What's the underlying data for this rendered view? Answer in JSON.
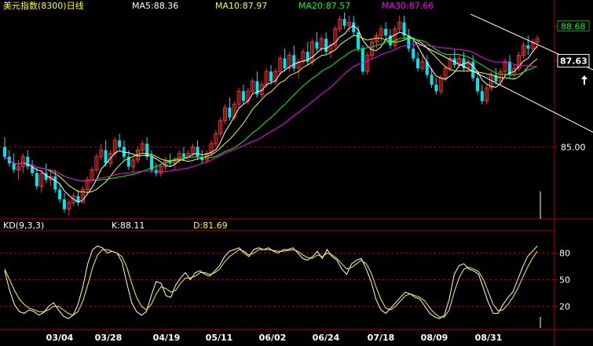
{
  "header": {
    "instrument": "美元指数(8300)日线",
    "ma5": "MA5:88.36",
    "ma10": "MA10:87.97",
    "ma20": "MA20:87.57",
    "ma30": "MA30:87.66"
  },
  "kd_header": {
    "name": "KD(9,3,3)",
    "k": "K:88.11",
    "d": "D:81.69"
  },
  "colors": {
    "up": "#ff3030",
    "down": "#00e5ee",
    "ma5": "#ffffff",
    "ma10": "#ffff00",
    "ma20": "#00ff00",
    "ma30": "#ff00ff",
    "channel": "#ffffff",
    "frame": "#b00000",
    "k": "#ffffff",
    "d": "#ffff00",
    "axis_text": "#ffffff",
    "header_ma5": "#ffffff",
    "header_ma10": "#ffff00",
    "header_ma20": "#00ff00",
    "header_ma30": "#ff00ff",
    "header_title": "#ffff00"
  },
  "chart_data": [
    {
      "type": "candlestick",
      "title": "美元指数(8300)日线",
      "x_ticks": [
        "03/04",
        "03/28",
        "04/19",
        "05/11",
        "06/02",
        "06/24",
        "07/18",
        "08/09",
        "08/31"
      ],
      "y_ticks": [
        "88.68",
        "87.63",
        "85.00"
      ],
      "y_range": [
        82.9,
        89.1
      ],
      "channel_lines": [
        {
          "from": [
            101.5,
            89.05
          ],
          "to": [
            134.5,
            86.95
          ]
        },
        {
          "from": [
            89.5,
            88.2
          ],
          "to": [
            134.5,
            85.0
          ]
        }
      ],
      "series": [
        {
          "name": "MA5",
          "value": 88.36
        },
        {
          "name": "MA10",
          "value": 87.97
        },
        {
          "name": "MA20",
          "value": 87.57
        },
        {
          "name": "MA30",
          "value": 87.66
        }
      ],
      "ohlc": [
        [
          85.0,
          85.3,
          84.6,
          84.7
        ],
        [
          84.7,
          84.9,
          84.4,
          84.5
        ],
        [
          84.5,
          84.8,
          84.2,
          84.3
        ],
        [
          84.3,
          84.6,
          84.0,
          84.4
        ],
        [
          84.4,
          84.8,
          84.2,
          84.7
        ],
        [
          84.7,
          84.9,
          84.3,
          84.4
        ],
        [
          84.4,
          84.6,
          84.1,
          84.2
        ],
        [
          84.2,
          84.4,
          83.7,
          83.8
        ],
        [
          83.8,
          84.3,
          83.6,
          84.2
        ],
        [
          84.2,
          84.5,
          83.9,
          84.0
        ],
        [
          84.0,
          84.3,
          83.8,
          84.1
        ],
        [
          84.1,
          84.3,
          83.6,
          83.7
        ],
        [
          83.7,
          83.9,
          83.3,
          83.4
        ],
        [
          83.4,
          83.6,
          83.0,
          83.1
        ],
        [
          83.1,
          83.4,
          82.9,
          83.3
        ],
        [
          83.3,
          83.6,
          83.2,
          83.5
        ],
        [
          83.5,
          83.7,
          83.2,
          83.3
        ],
        [
          83.3,
          83.8,
          83.3,
          83.7
        ],
        [
          83.7,
          84.1,
          83.6,
          84.0
        ],
        [
          84.0,
          84.4,
          83.9,
          84.3
        ],
        [
          84.3,
          84.8,
          84.2,
          84.7
        ],
        [
          84.7,
          85.1,
          84.6,
          84.9
        ],
        [
          84.9,
          85.2,
          84.4,
          84.5
        ],
        [
          84.5,
          84.9,
          84.4,
          84.8
        ],
        [
          84.8,
          85.3,
          84.7,
          85.2
        ],
        [
          85.2,
          85.4,
          84.9,
          85.0
        ],
        [
          85.0,
          85.2,
          84.6,
          84.7
        ],
        [
          84.7,
          84.9,
          84.3,
          84.4
        ],
        [
          84.4,
          84.7,
          84.2,
          84.6
        ],
        [
          84.6,
          85.0,
          84.5,
          84.9
        ],
        [
          84.9,
          85.2,
          84.8,
          85.1
        ],
        [
          85.1,
          85.3,
          84.6,
          84.7
        ],
        [
          84.7,
          84.9,
          84.2,
          84.3
        ],
        [
          84.3,
          84.5,
          84.1,
          84.2
        ],
        [
          84.2,
          84.5,
          84.1,
          84.4
        ],
        [
          84.4,
          84.7,
          84.3,
          84.6
        ],
        [
          84.6,
          84.8,
          84.4,
          84.5
        ],
        [
          84.5,
          84.7,
          84.3,
          84.6
        ],
        [
          84.6,
          84.9,
          84.5,
          84.8
        ],
        [
          84.8,
          85.0,
          84.6,
          84.7
        ],
        [
          84.7,
          84.9,
          84.6,
          84.8
        ],
        [
          84.8,
          85.1,
          84.7,
          85.0
        ],
        [
          85.0,
          85.2,
          84.6,
          84.7
        ],
        [
          84.7,
          84.9,
          84.5,
          84.6
        ],
        [
          84.6,
          84.9,
          84.5,
          84.8
        ],
        [
          84.8,
          85.2,
          84.7,
          85.1
        ],
        [
          85.1,
          85.5,
          85.0,
          85.4
        ],
        [
          85.4,
          85.9,
          85.3,
          85.8
        ],
        [
          85.8,
          86.3,
          85.7,
          86.2
        ],
        [
          86.2,
          86.5,
          85.8,
          85.9
        ],
        [
          85.9,
          86.4,
          85.8,
          86.3
        ],
        [
          86.3,
          86.8,
          86.2,
          86.7
        ],
        [
          86.7,
          86.9,
          86.3,
          86.4
        ],
        [
          86.4,
          86.8,
          86.3,
          86.7
        ],
        [
          86.7,
          87.1,
          86.6,
          87.0
        ],
        [
          87.0,
          87.3,
          86.5,
          86.6
        ],
        [
          86.6,
          87.0,
          86.5,
          86.9
        ],
        [
          86.9,
          87.4,
          86.8,
          87.3
        ],
        [
          87.3,
          87.5,
          86.9,
          87.0
        ],
        [
          87.0,
          87.4,
          86.9,
          87.3
        ],
        [
          87.3,
          87.8,
          87.2,
          87.7
        ],
        [
          87.7,
          88.0,
          87.3,
          87.4
        ],
        [
          87.4,
          87.9,
          87.3,
          87.8
        ],
        [
          87.8,
          88.1,
          87.3,
          87.4
        ],
        [
          87.4,
          87.7,
          87.1,
          87.6
        ],
        [
          87.6,
          88.0,
          87.5,
          87.9
        ],
        [
          87.9,
          88.2,
          87.5,
          87.6
        ],
        [
          87.6,
          88.3,
          87.5,
          88.2
        ],
        [
          88.2,
          88.5,
          87.9,
          88.0
        ],
        [
          88.0,
          88.4,
          87.9,
          88.3
        ],
        [
          88.3,
          88.5,
          87.8,
          87.9
        ],
        [
          87.9,
          88.2,
          87.7,
          88.1
        ],
        [
          88.1,
          88.7,
          88.0,
          88.6
        ],
        [
          88.6,
          89.0,
          88.5,
          88.9
        ],
        [
          88.9,
          89.1,
          88.6,
          88.7
        ],
        [
          88.7,
          89.0,
          88.5,
          88.8
        ],
        [
          88.8,
          89.0,
          88.4,
          88.5
        ],
        [
          88.5,
          88.7,
          87.9,
          88.0
        ],
        [
          88.0,
          88.1,
          87.2,
          87.3
        ],
        [
          87.3,
          87.9,
          87.2,
          87.8
        ],
        [
          87.8,
          88.3,
          87.7,
          88.2
        ],
        [
          88.2,
          88.5,
          88.0,
          88.4
        ],
        [
          88.4,
          88.7,
          88.2,
          88.6
        ],
        [
          88.6,
          88.8,
          88.3,
          88.4
        ],
        [
          88.4,
          88.6,
          88.0,
          88.1
        ],
        [
          88.1,
          88.7,
          88.0,
          88.6
        ],
        [
          88.6,
          89.0,
          88.5,
          88.8
        ],
        [
          88.8,
          89.0,
          88.3,
          88.4
        ],
        [
          88.4,
          88.6,
          87.9,
          88.0
        ],
        [
          88.0,
          88.3,
          87.6,
          87.7
        ],
        [
          87.7,
          87.9,
          87.3,
          87.4
        ],
        [
          87.4,
          87.8,
          87.3,
          87.6
        ],
        [
          87.6,
          87.8,
          87.1,
          87.2
        ],
        [
          87.2,
          87.4,
          86.8,
          86.9
        ],
        [
          86.9,
          87.1,
          86.6,
          86.7
        ],
        [
          86.7,
          87.2,
          86.6,
          87.1
        ],
        [
          87.1,
          87.5,
          87.0,
          87.4
        ],
        [
          87.4,
          87.8,
          87.3,
          87.7
        ],
        [
          87.7,
          88.0,
          87.4,
          87.5
        ],
        [
          87.5,
          87.8,
          87.4,
          87.7
        ],
        [
          87.7,
          87.9,
          87.3,
          87.4
        ],
        [
          87.4,
          87.7,
          87.3,
          87.6
        ],
        [
          87.6,
          87.8,
          87.0,
          87.1
        ],
        [
          87.1,
          87.3,
          86.6,
          86.7
        ],
        [
          86.7,
          86.9,
          86.3,
          86.4
        ],
        [
          86.4,
          86.9,
          86.3,
          86.8
        ],
        [
          86.8,
          87.3,
          86.7,
          87.2
        ],
        [
          87.2,
          87.4,
          86.9,
          87.0
        ],
        [
          87.0,
          87.4,
          86.9,
          87.3
        ],
        [
          87.3,
          87.7,
          87.2,
          87.6
        ],
        [
          87.6,
          87.8,
          87.1,
          87.2
        ],
        [
          87.2,
          87.5,
          87.1,
          87.4
        ],
        [
          87.4,
          87.9,
          87.3,
          87.8
        ],
        [
          87.8,
          88.2,
          87.7,
          88.1
        ],
        [
          88.1,
          88.4,
          87.8,
          88.0
        ],
        [
          88.0,
          88.3,
          87.9,
          88.2
        ],
        [
          88.2,
          88.4,
          88.0,
          88.3
        ]
      ]
    },
    {
      "type": "line",
      "title": "KD(9,3,3)",
      "y_ticks": [
        "80",
        "50",
        "20"
      ],
      "y_range": [
        0,
        100
      ],
      "x_ticks": [
        "03/04",
        "03/28",
        "04/19",
        "05/11",
        "06/02",
        "06/24",
        "07/18",
        "08/09",
        "08/31"
      ],
      "series": [
        {
          "name": "K",
          "value": 88.11,
          "values": [
            60,
            38,
            22,
            14,
            12,
            16,
            14,
            10,
            13,
            20,
            24,
            16,
            9,
            6,
            10,
            22,
            42,
            68,
            84,
            88,
            86,
            80,
            82,
            80,
            70,
            46,
            24,
            14,
            10,
            14,
            32,
            48,
            46,
            32,
            30,
            44,
            52,
            58,
            50,
            58,
            60,
            56,
            54,
            60,
            66,
            76,
            82,
            84,
            86,
            80,
            76,
            84,
            86,
            84,
            86,
            82,
            80,
            84,
            84,
            86,
            80,
            74,
            72,
            76,
            82,
            74,
            84,
            76,
            72,
            62,
            56,
            68,
            72,
            74,
            62,
            48,
            28,
            16,
            12,
            18,
            24,
            30,
            36,
            34,
            30,
            28,
            20,
            12,
            8,
            6,
            10,
            28,
            56,
            66,
            68,
            62,
            60,
            56,
            40,
            24,
            12,
            12,
            22,
            30,
            36,
            50,
            64,
            76,
            82,
            88
          ]
        },
        {
          "name": "D",
          "value": 81.69,
          "values": [
            62,
            50,
            38,
            28,
            22,
            18,
            16,
            14,
            14,
            16,
            20,
            20,
            16,
            12,
            10,
            14,
            26,
            44,
            64,
            78,
            84,
            84,
            82,
            80,
            76,
            64,
            46,
            30,
            20,
            16,
            22,
            34,
            42,
            40,
            36,
            38,
            46,
            52,
            52,
            54,
            58,
            58,
            56,
            58,
            62,
            70,
            76,
            80,
            84,
            82,
            78,
            80,
            84,
            84,
            84,
            83,
            82,
            82,
            83,
            84,
            82,
            78,
            75,
            74,
            78,
            76,
            80,
            78,
            74,
            68,
            62,
            64,
            68,
            72,
            68,
            58,
            42,
            28,
            18,
            16,
            20,
            26,
            32,
            34,
            32,
            30,
            26,
            18,
            12,
            8,
            8,
            16,
            36,
            52,
            62,
            64,
            62,
            59,
            50,
            36,
            22,
            15,
            16,
            22,
            30,
            40,
            52,
            64,
            74,
            82
          ]
        }
      ]
    }
  ]
}
